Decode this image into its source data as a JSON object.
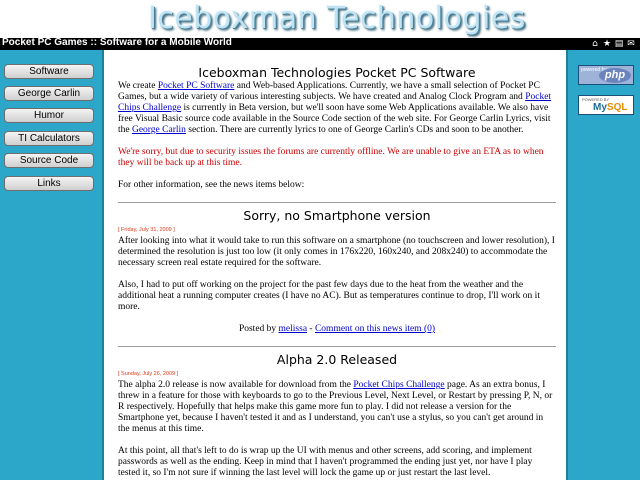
{
  "site": {
    "banner_title": "Iceboxman Technologies",
    "topbar_title": "Pocket PC Games :: Software for a Mobile World",
    "topbar_icons": [
      "home-icon",
      "bookmark-icon",
      "printer-icon",
      "email-icon"
    ]
  },
  "nav": {
    "items": [
      {
        "label": "Software"
      },
      {
        "label": "George Carlin"
      },
      {
        "label": "Humor"
      },
      {
        "label": "TI Calculators"
      },
      {
        "label": "Source Code"
      },
      {
        "label": "Links"
      }
    ]
  },
  "badges": {
    "php": {
      "small": "powered by",
      "logo": "php"
    },
    "mysql": {
      "small": "POWERED BY",
      "logo_a": "My",
      "logo_b": "SQL"
    }
  },
  "intro": {
    "title": "Iceboxman Technologies Pocket PC Software",
    "p1_a": "We create ",
    "p1_link1": "Pocket PC Software",
    "p1_b": " and Web-based Applications. Currently, we have a small selection of Pocket PC Games, but a wide variety of various interesting subjects. We have created and Analog Clock Program and ",
    "p1_link2": "Pocket Chips Challenge",
    "p1_c": " is currently in Beta version, but we'll soon have some Web Applications available. We also have free Visual Basic source code available in the Source Code section of the web site. For George Carlin Lyrics, visit the ",
    "p1_link3": "George Carlin",
    "p1_d": " section. There are currently lyrics to one of George Carlin's CDs and soon to be another.",
    "notice": "We're sorry, but due to security issues the forums are currently offline. We are unable to give an ETA as to when they will be back up at this time.",
    "p3": "For other information, see the news items below:"
  },
  "news": [
    {
      "title": "Sorry, no Smartphone version",
      "date": "[ Friday, July 31, 2009 ]",
      "p1": "After looking into what it would take to run this software on a smartphone (no touchscreen and lower resolution), I determined the resolution is just too low (it only comes in 176x220, 160x240, and 208x240) to accommodate the necessary screen real estate required for the software.",
      "p2": "Also, I had to put off working on the project for the past few days due to the heat from the weather and the additional heat a running computer creates (I have no AC). But as temperatures continue to drop, I'll work on it more.",
      "posted_by": "Posted by ",
      "author": "melissa",
      "sep": " - ",
      "comment_link": "Comment on this news item (0)"
    },
    {
      "title": "Alpha 2.0 Released",
      "date": "[ Sunday, July 26, 2009 ]",
      "p1_a": "The alpha 2.0 release is now available for download from the ",
      "p1_link": "Pocket Chips Challenge",
      "p1_b": " page. As an extra bonus, I threw in a feature for those with keyboards to go to the Previous Level, Next Level, or Restart by pressing P, N, or R respectively. Hopefully that helps make this game more fun to play. I did not release a version for the Smartphone yet, because I haven't tested it and as I understand, you can't use a stylus, so you can't get around in the menus at this time.",
      "p2": "At this point, all that's left to do is wrap up the UI with menus and other screens, add scoring, and implement passwords as well as the ending. Keep in mind that I haven't programmed the ending just yet, nor have I play tested it, so I'm not sure if winning the last level will lock the game up or just restart the last level."
    }
  ]
}
